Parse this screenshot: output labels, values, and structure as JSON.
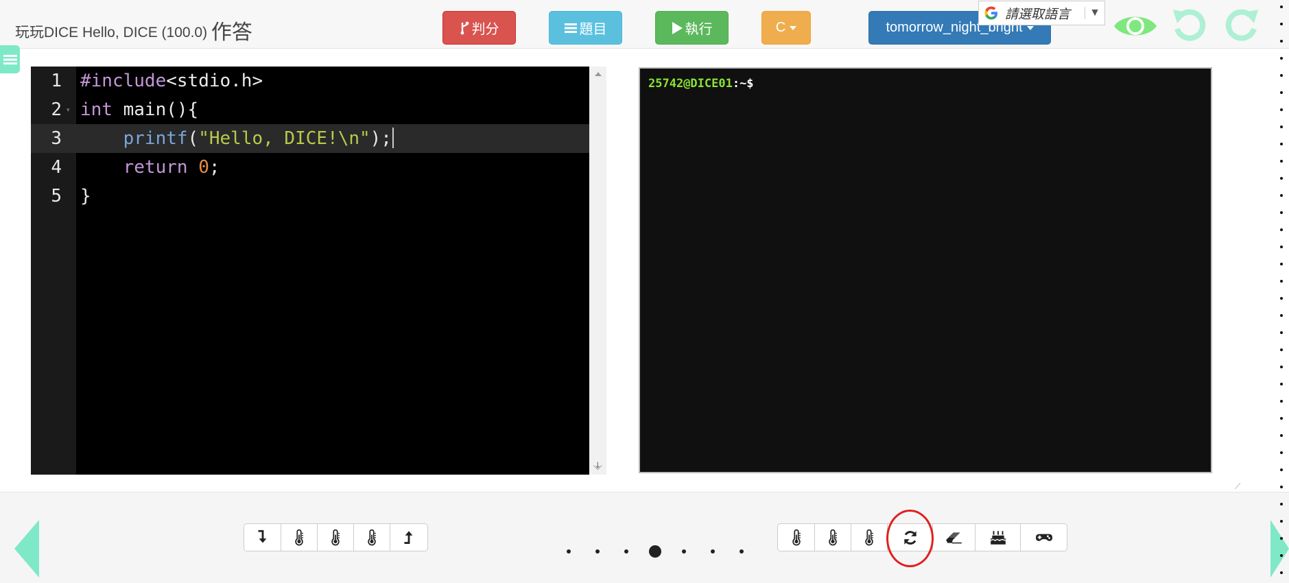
{
  "header": {
    "title_prefix": "玩玩DICE Hello, DICE (100.0)",
    "title_suffix": "作答"
  },
  "toolbar": {
    "score_label": "判分",
    "problem_label": "題目",
    "run_label": "執行",
    "language": "C",
    "theme": "tomorrow_night_bright"
  },
  "translate": {
    "label": "請選取語言",
    "arrow": "▼"
  },
  "top_icons": [
    "eye-icon",
    "undo-icon",
    "redo-icon"
  ],
  "editor": {
    "lines": [
      {
        "n": "1",
        "tokens": [
          {
            "t": "#include",
            "c": "kw"
          },
          {
            "t": "<stdio.h>",
            "c": ""
          }
        ]
      },
      {
        "n": "2",
        "tokens": [
          {
            "t": "int",
            "c": "kw"
          },
          {
            "t": " main(){",
            "c": ""
          }
        ]
      },
      {
        "n": "3",
        "tokens": [
          {
            "t": "    ",
            "c": ""
          },
          {
            "t": "printf",
            "c": "fn"
          },
          {
            "t": "(",
            "c": ""
          },
          {
            "t": "\"Hello, DICE!\\n\"",
            "c": "str"
          },
          {
            "t": ");",
            "c": ""
          }
        ]
      },
      {
        "n": "4",
        "tokens": [
          {
            "t": "    ",
            "c": ""
          },
          {
            "t": "return",
            "c": "kw"
          },
          {
            "t": " ",
            "c": ""
          },
          {
            "t": "0",
            "c": "num"
          },
          {
            "t": ";",
            "c": ""
          }
        ]
      },
      {
        "n": "5",
        "tokens": [
          {
            "t": "}",
            "c": ""
          }
        ]
      }
    ],
    "active_line": 3
  },
  "terminal": {
    "user": "25742@DICE01",
    "rest": ":~$"
  },
  "bottom": {
    "left_group": [
      "step-into-icon",
      "thermometer-icon",
      "thermometer-icon",
      "thermometer-icon",
      "step-out-icon"
    ],
    "right_group": [
      "thermometer-icon",
      "thermometer-icon",
      "thermometer-icon",
      "refresh-icon",
      "eraser-icon",
      "cake-icon",
      "gamepad-icon"
    ],
    "page_dots": 7,
    "active_dot": 4
  },
  "colors": {
    "accent": "#7ee8c7",
    "score": "#d9534f",
    "problem": "#5bc0de",
    "run": "#5cb85c",
    "language": "#f0ad4e",
    "theme": "#337ab7",
    "highlight": "#e02020"
  }
}
